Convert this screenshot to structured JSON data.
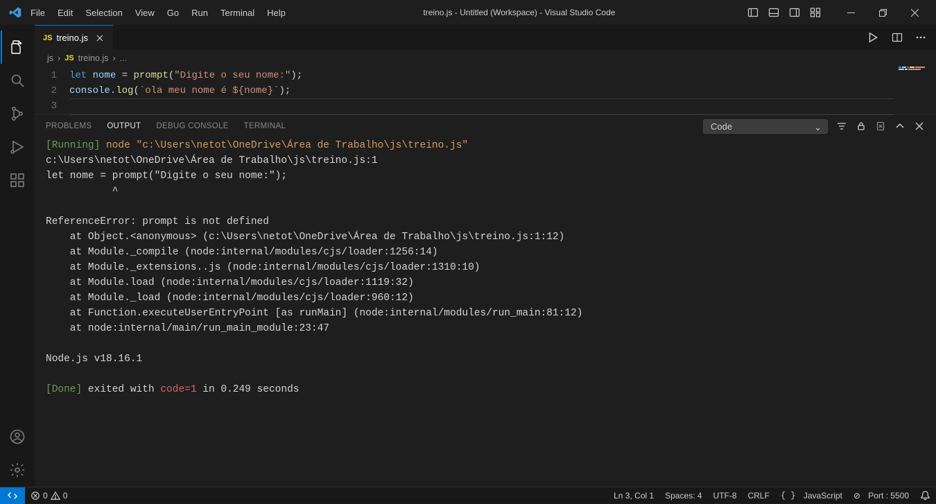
{
  "title": "treino.js - Untitled (Workspace) - Visual Studio Code",
  "menu": [
    "File",
    "Edit",
    "Selection",
    "View",
    "Go",
    "Run",
    "Terminal",
    "Help"
  ],
  "tab": {
    "label": "treino.js",
    "lang_icon": "JS"
  },
  "breadcrumb": {
    "folder": "js",
    "file": "treino.js",
    "rest": "..."
  },
  "code": {
    "l1": {
      "kw": "let",
      "var": "nome",
      "eq": " = ",
      "fn": "prompt",
      "lp": "(",
      "str": "\"Digite o seu nome:\"",
      "rp": ");"
    },
    "l2": {
      "obj": "console",
      "dot": ".",
      "fn": "log",
      "lp": "(",
      "str": "`ola meu nome é ${nome}`",
      "rp": ");"
    }
  },
  "panel": {
    "tabs": [
      "PROBLEMS",
      "OUTPUT",
      "DEBUG CONSOLE",
      "TERMINAL"
    ],
    "select": "Code"
  },
  "output": {
    "run_label": "[Running]",
    "run_cmd": " node \"c:\\Users\\netot\\OneDrive\\Área de Trabalho\\js\\treino.js\"",
    "lines": [
      "c:\\Users\\netot\\OneDrive\\Área de Trabalho\\js\\treino.js:1",
      "let nome = prompt(\"Digite o seu nome:\");",
      "           ^",
      "",
      "ReferenceError: prompt is not defined",
      "    at Object.<anonymous> (c:\\Users\\netot\\OneDrive\\Área de Trabalho\\js\\treino.js:1:12)",
      "    at Module._compile (node:internal/modules/cjs/loader:1256:14)",
      "    at Module._extensions..js (node:internal/modules/cjs/loader:1310:10)",
      "    at Module.load (node:internal/modules/cjs/loader:1119:32)",
      "    at Module._load (node:internal/modules/cjs/loader:960:12)",
      "    at Function.executeUserEntryPoint [as runMain] (node:internal/modules/run_main:81:12)",
      "    at node:internal/main/run_main_module:23:47",
      "",
      "Node.js v18.16.1",
      ""
    ],
    "done_label": "[Done]",
    "done_pre": " exited with ",
    "done_code": "code=1",
    "done_post": " in 0.249 seconds"
  },
  "status": {
    "errors": "0",
    "warnings": "0",
    "position": "Ln 3, Col 1",
    "spaces": "Spaces: 4",
    "encoding": "UTF-8",
    "eol": "CRLF",
    "lang": "JavaScript",
    "port": "Port : 5500",
    "port_icon_label": "⊘"
  }
}
